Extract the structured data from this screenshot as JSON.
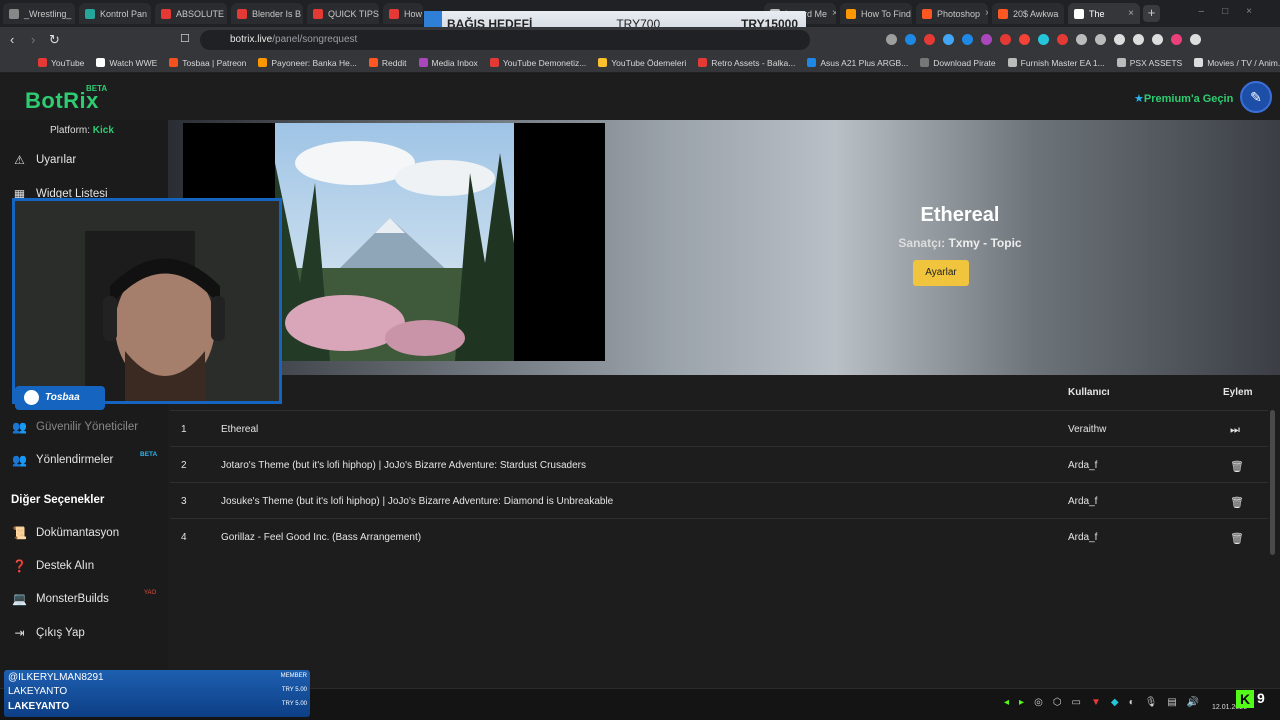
{
  "browser": {
    "tabs": [
      {
        "label": "_Wrestling_",
        "color": "#888888"
      },
      {
        "label": "Kontrol Pan",
        "color": "#26a69a"
      },
      {
        "label": "ABSOLUTE",
        "color": "#e53935"
      },
      {
        "label": "Blender Is B",
        "color": "#e53935"
      },
      {
        "label": "QUICK TIPS",
        "color": "#e53935"
      },
      {
        "label": "How",
        "color": "#e53935"
      },
      {
        "label": "Inward Me",
        "color": "#bbbbbb"
      },
      {
        "label": "How To Find",
        "color": "#ff9800"
      },
      {
        "label": "Photoshop",
        "color": "#ff5722"
      },
      {
        "label": "20$ Awkwa",
        "color": "#ff5722"
      },
      {
        "label": "The",
        "color": "#ffffff"
      }
    ],
    "new_tab": "+",
    "url_host": "botrix.live",
    "url_path": "/panel/songrequest",
    "bookmarks": [
      {
        "label": "YouTube",
        "color": "#e53935"
      },
      {
        "label": "Watch WWE",
        "color": "#ffffff"
      },
      {
        "label": "Tosbaa | Patreon",
        "color": "#f4511e"
      },
      {
        "label": "Payoneer: Banka He...",
        "color": "#ff9800"
      },
      {
        "label": "Reddit",
        "color": "#ff5722"
      },
      {
        "label": "Media Inbox",
        "color": "#ab47bc"
      },
      {
        "label": "YouTube Demonetiz...",
        "color": "#e53935"
      },
      {
        "label": "YouTube Ödemeleri",
        "color": "#fbc02d"
      },
      {
        "label": "Retro Assets - Balka...",
        "color": "#e53935"
      },
      {
        "label": "Asus A21 Plus ARGB...",
        "color": "#1e88e5"
      },
      {
        "label": "Download Pirate",
        "color": "#777777"
      },
      {
        "label": "Furnish Master EA 1...",
        "color": "#bbbbbb"
      },
      {
        "label": "PSX ASSETS",
        "color": "#bbbbbb"
      },
      {
        "label": "Movies / TV / Anim...",
        "color": "#dddddd"
      }
    ]
  },
  "overlay": {
    "donation_label": "BAĞIŞ HEDEFİ",
    "donation_current": "TRY700",
    "donation_goal": "TRY15000"
  },
  "header": {
    "logo": "BotRix",
    "logo_badge": "BETA",
    "premium_label": "Premium'a Geçin"
  },
  "sidebar": {
    "platform_label": "Platform:",
    "platform_value": "Kick",
    "items_top": [
      {
        "label": "Uyarılar",
        "icon": "warning-icon"
      },
      {
        "label": "Widget Listesi",
        "icon": "grid-icon"
      }
    ],
    "items_mid": [
      {
        "label": "Güvenilir Yöneticiler",
        "icon": "users-icon"
      },
      {
        "label": "Yönlendirmeler",
        "icon": "users-icon",
        "badge": "BETA"
      }
    ],
    "section_title": "Diğer Seçenekler",
    "items_other": [
      {
        "label": "Dokümantasyon",
        "icon": "scroll-icon"
      },
      {
        "label": "Destek Alın",
        "icon": "question-icon"
      },
      {
        "label": "MonsterBuilds",
        "icon": "laptop-icon",
        "badge": "YAO"
      },
      {
        "label": "Çıkış Yap",
        "icon": "logout-icon"
      }
    ]
  },
  "player": {
    "title": "Ethereal",
    "artist_label": "Sanatçı:",
    "artist": "Txmy - Topic",
    "settings_button": "Ayarlar"
  },
  "queue": {
    "col_user": "Kullanıcı",
    "col_action": "Eylem",
    "rows": [
      {
        "num": "1",
        "title": "Ethereal",
        "user": "Veraithw",
        "action": "skip"
      },
      {
        "num": "2",
        "title": "Jotaro's Theme (but it's lofi hiphop) | JoJo's Bizarre Adventure: Stardust Crusaders",
        "user": "Arda_f",
        "action": "delete"
      },
      {
        "num": "3",
        "title": "Josuke's Theme (but it's lofi hiphop) | JoJo's Bizarre Adventure: Diamond is Unbreakable",
        "user": "Arda_f",
        "action": "delete"
      },
      {
        "num": "4",
        "title": "Gorillaz - Feel Good Inc. (Bass Arrangement)",
        "user": "Arda_f",
        "action": "delete"
      }
    ]
  },
  "stream": {
    "cam_name": "Tosbaa",
    "sub1": "@ILKERYLMAN8291",
    "sub1_tag": "MEMBER",
    "sub2": "LAKEYANTO",
    "sub2_tag": "TRY 5.00",
    "sub3": "LAKEYANTO",
    "sub3_tag": "TRY 5.00",
    "kick_badge": "K",
    "viewer_count": "9"
  },
  "taskbar": {
    "date": "12.01.2026"
  }
}
